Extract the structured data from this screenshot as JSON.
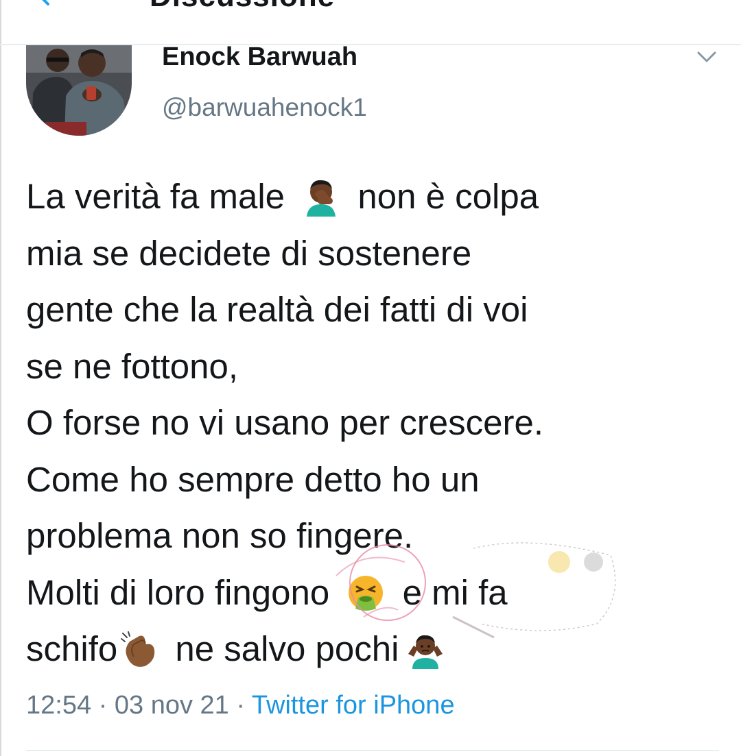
{
  "header": {
    "title": "Discussione",
    "back_icon": "arrow-left-icon"
  },
  "tweet": {
    "author": {
      "display_name": "Enock Barwuah",
      "handle": "@barwuahenock1",
      "avatar": "avatar-photo"
    },
    "more_icon": "chevron-down-icon",
    "lines": [
      {
        "segments": [
          "La verità fa male ",
          " non è colpa"
        ],
        "emoji": "man-facepalming-emoji"
      },
      {
        "text": "mia se decidete di sostenere"
      },
      {
        "text": "gente che la realtà dei fatti di voi"
      },
      {
        "text": "se ne fottono,"
      },
      {
        "text": "O forse no vi usano per crescere."
      },
      {
        "text": "Come ho sempre detto ho un"
      },
      {
        "text": "problema non so fingere."
      },
      {
        "segments": [
          "Molti di loro fingono ",
          " e mi fa"
        ],
        "emoji": "face-vomiting-emoji"
      },
      {
        "segments": [
          "schifo",
          " ne salvo pochi"
        ],
        "emojis": [
          "clapping-hands-emoji",
          "man-shrugging-emoji"
        ]
      }
    ],
    "time": "12:54",
    "separator": " · ",
    "date": "03 nov 21",
    "source": "Twitter for iPhone"
  },
  "colors": {
    "text": "#14171a",
    "secondary": "#657786",
    "link": "#1b95e0",
    "divider": "#e6ecf0",
    "watermark": "#e88aa8"
  }
}
